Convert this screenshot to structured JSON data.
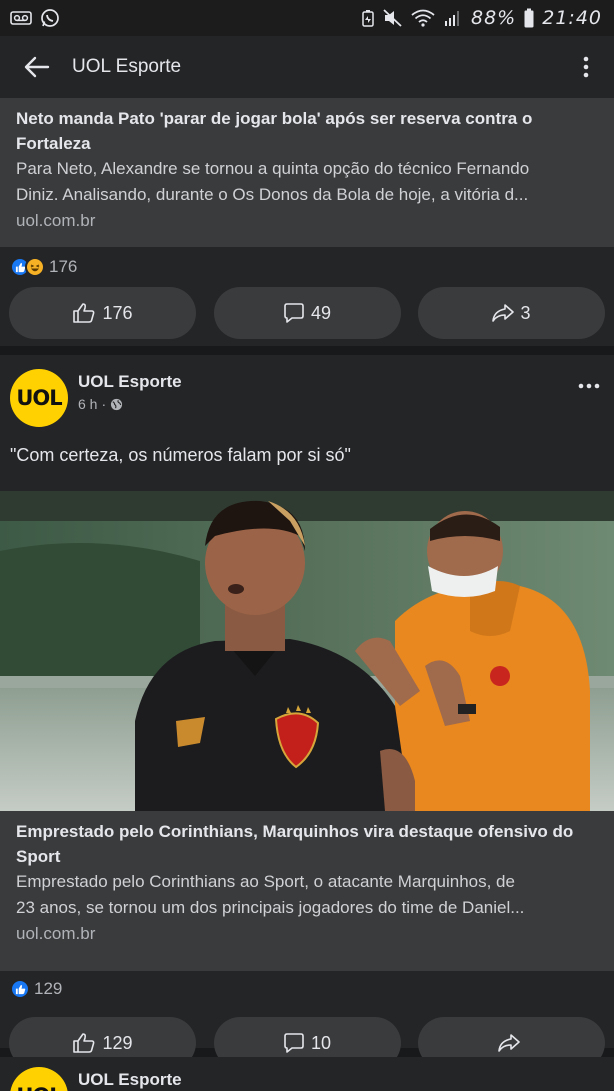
{
  "status_bar": {
    "battery": "88%",
    "time": "21:40",
    "icons": [
      "voicemail-icon",
      "whatsapp-icon",
      "battery-saver-icon",
      "mute-icon",
      "wifi-icon",
      "signal-icon",
      "battery-icon"
    ]
  },
  "header": {
    "title": "UOL Esporte",
    "back_icon": "arrow-left-icon",
    "menu_icon": "vertical-dots-icon"
  },
  "post1": {
    "link_title": "Neto manda Pato 'parar de jogar bola' após ser reserva contra o Fortaleza",
    "link_desc_1": "Para Neto, Alexandre se tornou a quinta opção do técnico Fernando",
    "link_desc_2": "Diniz. Analisando, durante o Os Donos da Bola de hoje, a vitória d...",
    "link_domain": "uol.com.br",
    "reaction_count": "176",
    "like_count": "176",
    "comment_count": "49",
    "share_count": "3"
  },
  "post2": {
    "author": "UOL Esporte",
    "avatar_text": "UOL",
    "time": "6 h",
    "privacy_icon": "globe-icon",
    "text": "\"Com certeza, os números falam por si só\"",
    "link_title": "Emprestado pelo Corinthians, Marquinhos vira destaque ofensivo do Sport",
    "link_desc_1": "Emprestado pelo Corinthians ao Sport, o atacante Marquinhos, de",
    "link_desc_2": "23 anos, se tornou um dos principais jogadores do time de Daniel...",
    "link_domain": "uol.com.br",
    "reaction_count": "129",
    "like_count": "129",
    "comment_count": "10",
    "share_count": ""
  },
  "post3": {
    "author": "UOL Esporte",
    "avatar_text": "UOL"
  },
  "colors": {
    "background": "#18191a",
    "card": "#242526",
    "button": "#3a3b3c",
    "accent_blue": "#1877f2",
    "uol_yellow": "#ffd100",
    "text_primary": "#e4e6eb",
    "text_secondary": "#b0b3b8"
  }
}
